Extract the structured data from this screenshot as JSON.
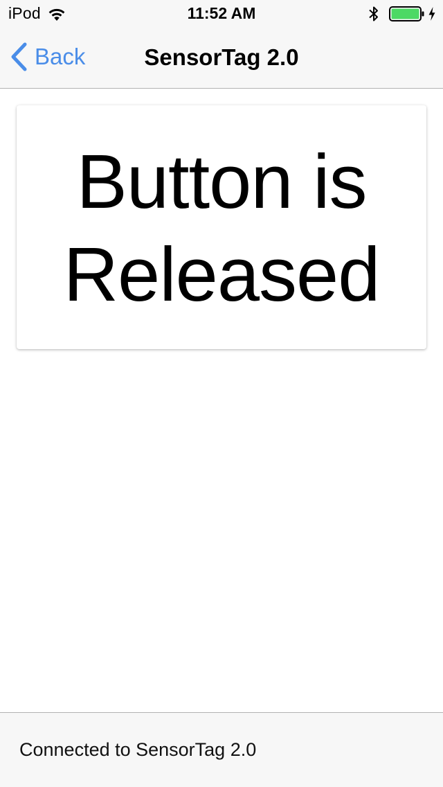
{
  "status_bar": {
    "carrier": "iPod",
    "time": "11:52 AM",
    "wifi_icon": "wifi-icon",
    "bluetooth_icon": "bluetooth-icon",
    "battery_icon": "battery-icon",
    "charging_icon": "charging-bolt-icon",
    "battery_level": 1.0,
    "battery_color": "#4cd964"
  },
  "nav_bar": {
    "back_label": "Back",
    "back_icon": "chevron-left-icon",
    "title": "SensorTag 2.0",
    "accent_color": "#4a8de8"
  },
  "card": {
    "line1": "Button is",
    "line2": "Released"
  },
  "footer": {
    "status": "Connected to SensorTag 2.0"
  }
}
